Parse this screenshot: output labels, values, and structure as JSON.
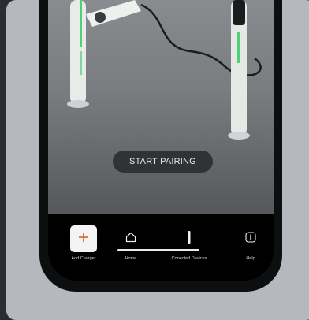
{
  "pairing": {
    "button_label": "START PAIRING"
  },
  "tabs": [
    {
      "label": "Add Charger",
      "icon": "plus-icon",
      "accent": "#e2682e"
    },
    {
      "label": "Home",
      "icon": "home-icon"
    },
    {
      "label": "Conected Devices",
      "icon": "charger-device-icon"
    },
    {
      "label": "Help",
      "icon": "info-icon"
    }
  ]
}
